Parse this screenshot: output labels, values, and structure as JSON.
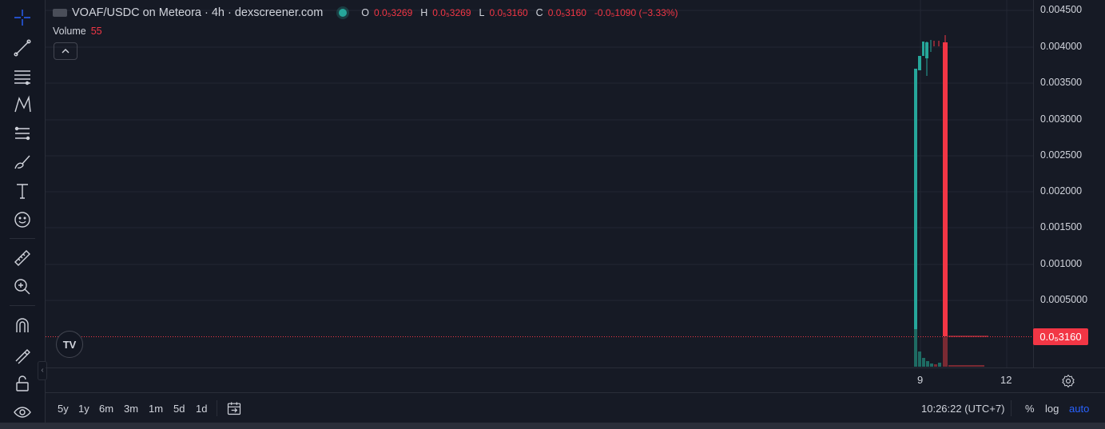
{
  "legend": {
    "symbol": "VOAF/USDC on Meteora · 4h · dexscreener.com",
    "o_key": "O",
    "o_val": "0.0₅3269",
    "h_key": "H",
    "h_val": "0.0₅3269",
    "l_key": "L",
    "l_val": "0.0₅3160",
    "c_key": "C",
    "c_val": "0.0₅3160",
    "change": "-0.0₅1090 (−3.33%)"
  },
  "volume": {
    "label": "Volume",
    "value": "55"
  },
  "price_axis": {
    "ticks": [
      "0.004500",
      "0.004000",
      "0.003500",
      "0.003000",
      "0.002500",
      "0.002000",
      "0.001500",
      "0.001000",
      "0.0005000"
    ],
    "last_price": "0.0₅3160"
  },
  "time_axis": {
    "labels": [
      "9",
      "12"
    ]
  },
  "bottom": {
    "ranges": [
      "5y",
      "1y",
      "6m",
      "3m",
      "1m",
      "5d",
      "1d"
    ],
    "clock": "10:26:22 (UTC+7)",
    "percent": "%",
    "log": "log",
    "auto": "auto"
  },
  "colors": {
    "up": "#26a69a",
    "down": "#f23645",
    "accent": "#2962ff",
    "background": "#161a25"
  },
  "icons": [
    "crosshair-icon",
    "trend-line-icon",
    "horizontal-lines-icon",
    "pattern-icon",
    "fib-icon",
    "brush-icon",
    "text-icon",
    "emoji-icon",
    "ruler-icon",
    "zoom-in-icon",
    "magnet-icon",
    "lock-draw-icon",
    "lock-icon",
    "eye-icon",
    "calendar-range-icon",
    "settings-gear-icon",
    "chevron-up-icon"
  ]
}
